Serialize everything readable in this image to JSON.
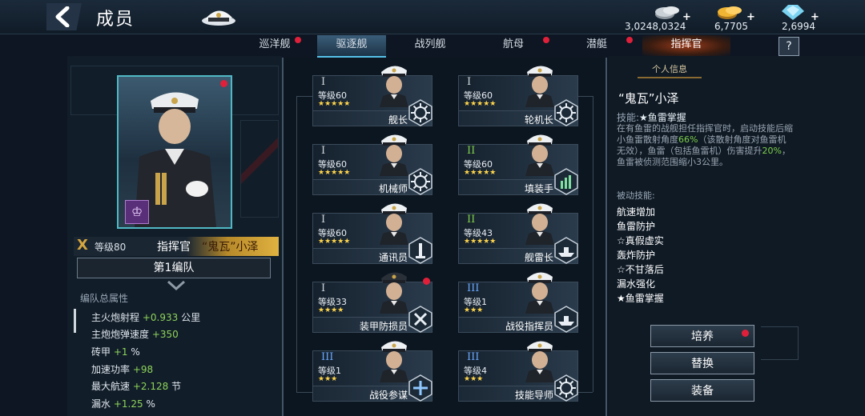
{
  "header": {
    "title": "成员",
    "resources": [
      {
        "name": "silver-coins",
        "value": "3,0248,0324"
      },
      {
        "name": "gold-coins",
        "value": "6,7705"
      },
      {
        "name": "diamonds",
        "value": "2,6994"
      }
    ]
  },
  "tabs": [
    {
      "label": "巡洋舰",
      "has_alert": true
    },
    {
      "label": "驱逐舰",
      "has_alert": false,
      "active": true
    },
    {
      "label": "战列舰",
      "has_alert": false
    },
    {
      "label": "航母",
      "has_alert": true
    },
    {
      "label": "潜艇",
      "has_alert": true
    },
    {
      "label": "指挥官",
      "has_alert": false
    }
  ],
  "help_label": "?",
  "commander": {
    "rank": "X",
    "level": "等级80",
    "role": "指挥官",
    "name": "“鬼瓦”小泽",
    "fleet": "第1编队"
  },
  "fleet_stats": {
    "title": "编队总属性",
    "items": [
      {
        "label": "主火炮射程",
        "value": "+0.933",
        "unit": "公里"
      },
      {
        "label": "主炮炮弹速度",
        "value": "+350",
        "unit": ""
      },
      {
        "label": "砖甲",
        "value": "+1",
        "unit": "%"
      },
      {
        "label": "加速功率",
        "value": "+98",
        "unit": ""
      },
      {
        "label": "最大航速",
        "value": "+2.128",
        "unit": "节"
      },
      {
        "label": "漏水",
        "value": "+1.25",
        "unit": "%"
      }
    ]
  },
  "crew": [
    {
      "rank": "I",
      "level": "等级60",
      "stars": "★★★★★",
      "role": "舰长"
    },
    {
      "rank": "I",
      "level": "等级60",
      "stars": "★★★★★",
      "role": "轮机长"
    },
    {
      "rank": "I",
      "level": "等级60",
      "stars": "★★★★★",
      "role": "机械师"
    },
    {
      "rank": "II",
      "level": "等级60",
      "stars": "★★★★★",
      "role": "填装手"
    },
    {
      "rank": "I",
      "level": "等级60",
      "stars": "★★★★★",
      "role": "通讯员"
    },
    {
      "rank": "II",
      "level": "等级43",
      "stars": "★★★★★",
      "role": "舰雷长"
    },
    {
      "rank": "I",
      "level": "等级33",
      "stars": "★★★★",
      "role": "装甲防损员"
    },
    {
      "rank": "III",
      "level": "等级1",
      "stars": "★★★",
      "role": "战役指挥员"
    },
    {
      "rank": "III",
      "level": "等级1",
      "stars": "★★★",
      "role": "战役参谋"
    },
    {
      "rank": "III",
      "level": "等级4",
      "stars": "★★★",
      "role": "技能导师"
    }
  ],
  "info": {
    "tab_label": "个人信息",
    "name": "“鬼瓦”小泽",
    "skill_label": "技能:",
    "skill_name": "★鱼雷掌握",
    "desc_parts": [
      "在有鱼雷的战舰担任指挥官时，启动技能后缩小鱼雷散射角度",
      "66%",
      "（该散射角度对鱼雷机无效），鱼雷（包括鱼雷机）伤害提升",
      "20%",
      "，鱼雷被侦测范围缩小3公里。"
    ],
    "passive_title": "被动技能:",
    "passives": [
      "航速增加",
      "鱼雷防护",
      "☆真假虚实",
      "轰炸防护",
      "☆不甘落后",
      "漏水强化",
      "★鱼雷掌握"
    ]
  },
  "buttons": {
    "train": "培养",
    "replace": "替换",
    "equip": "装备"
  },
  "colors": {
    "accent_cyan": "#56c2e8",
    "alert_red": "#e0203a",
    "stat_green": "#8fd45a",
    "star_gold": "#ffd54a",
    "name_gold": "#e0b240"
  }
}
